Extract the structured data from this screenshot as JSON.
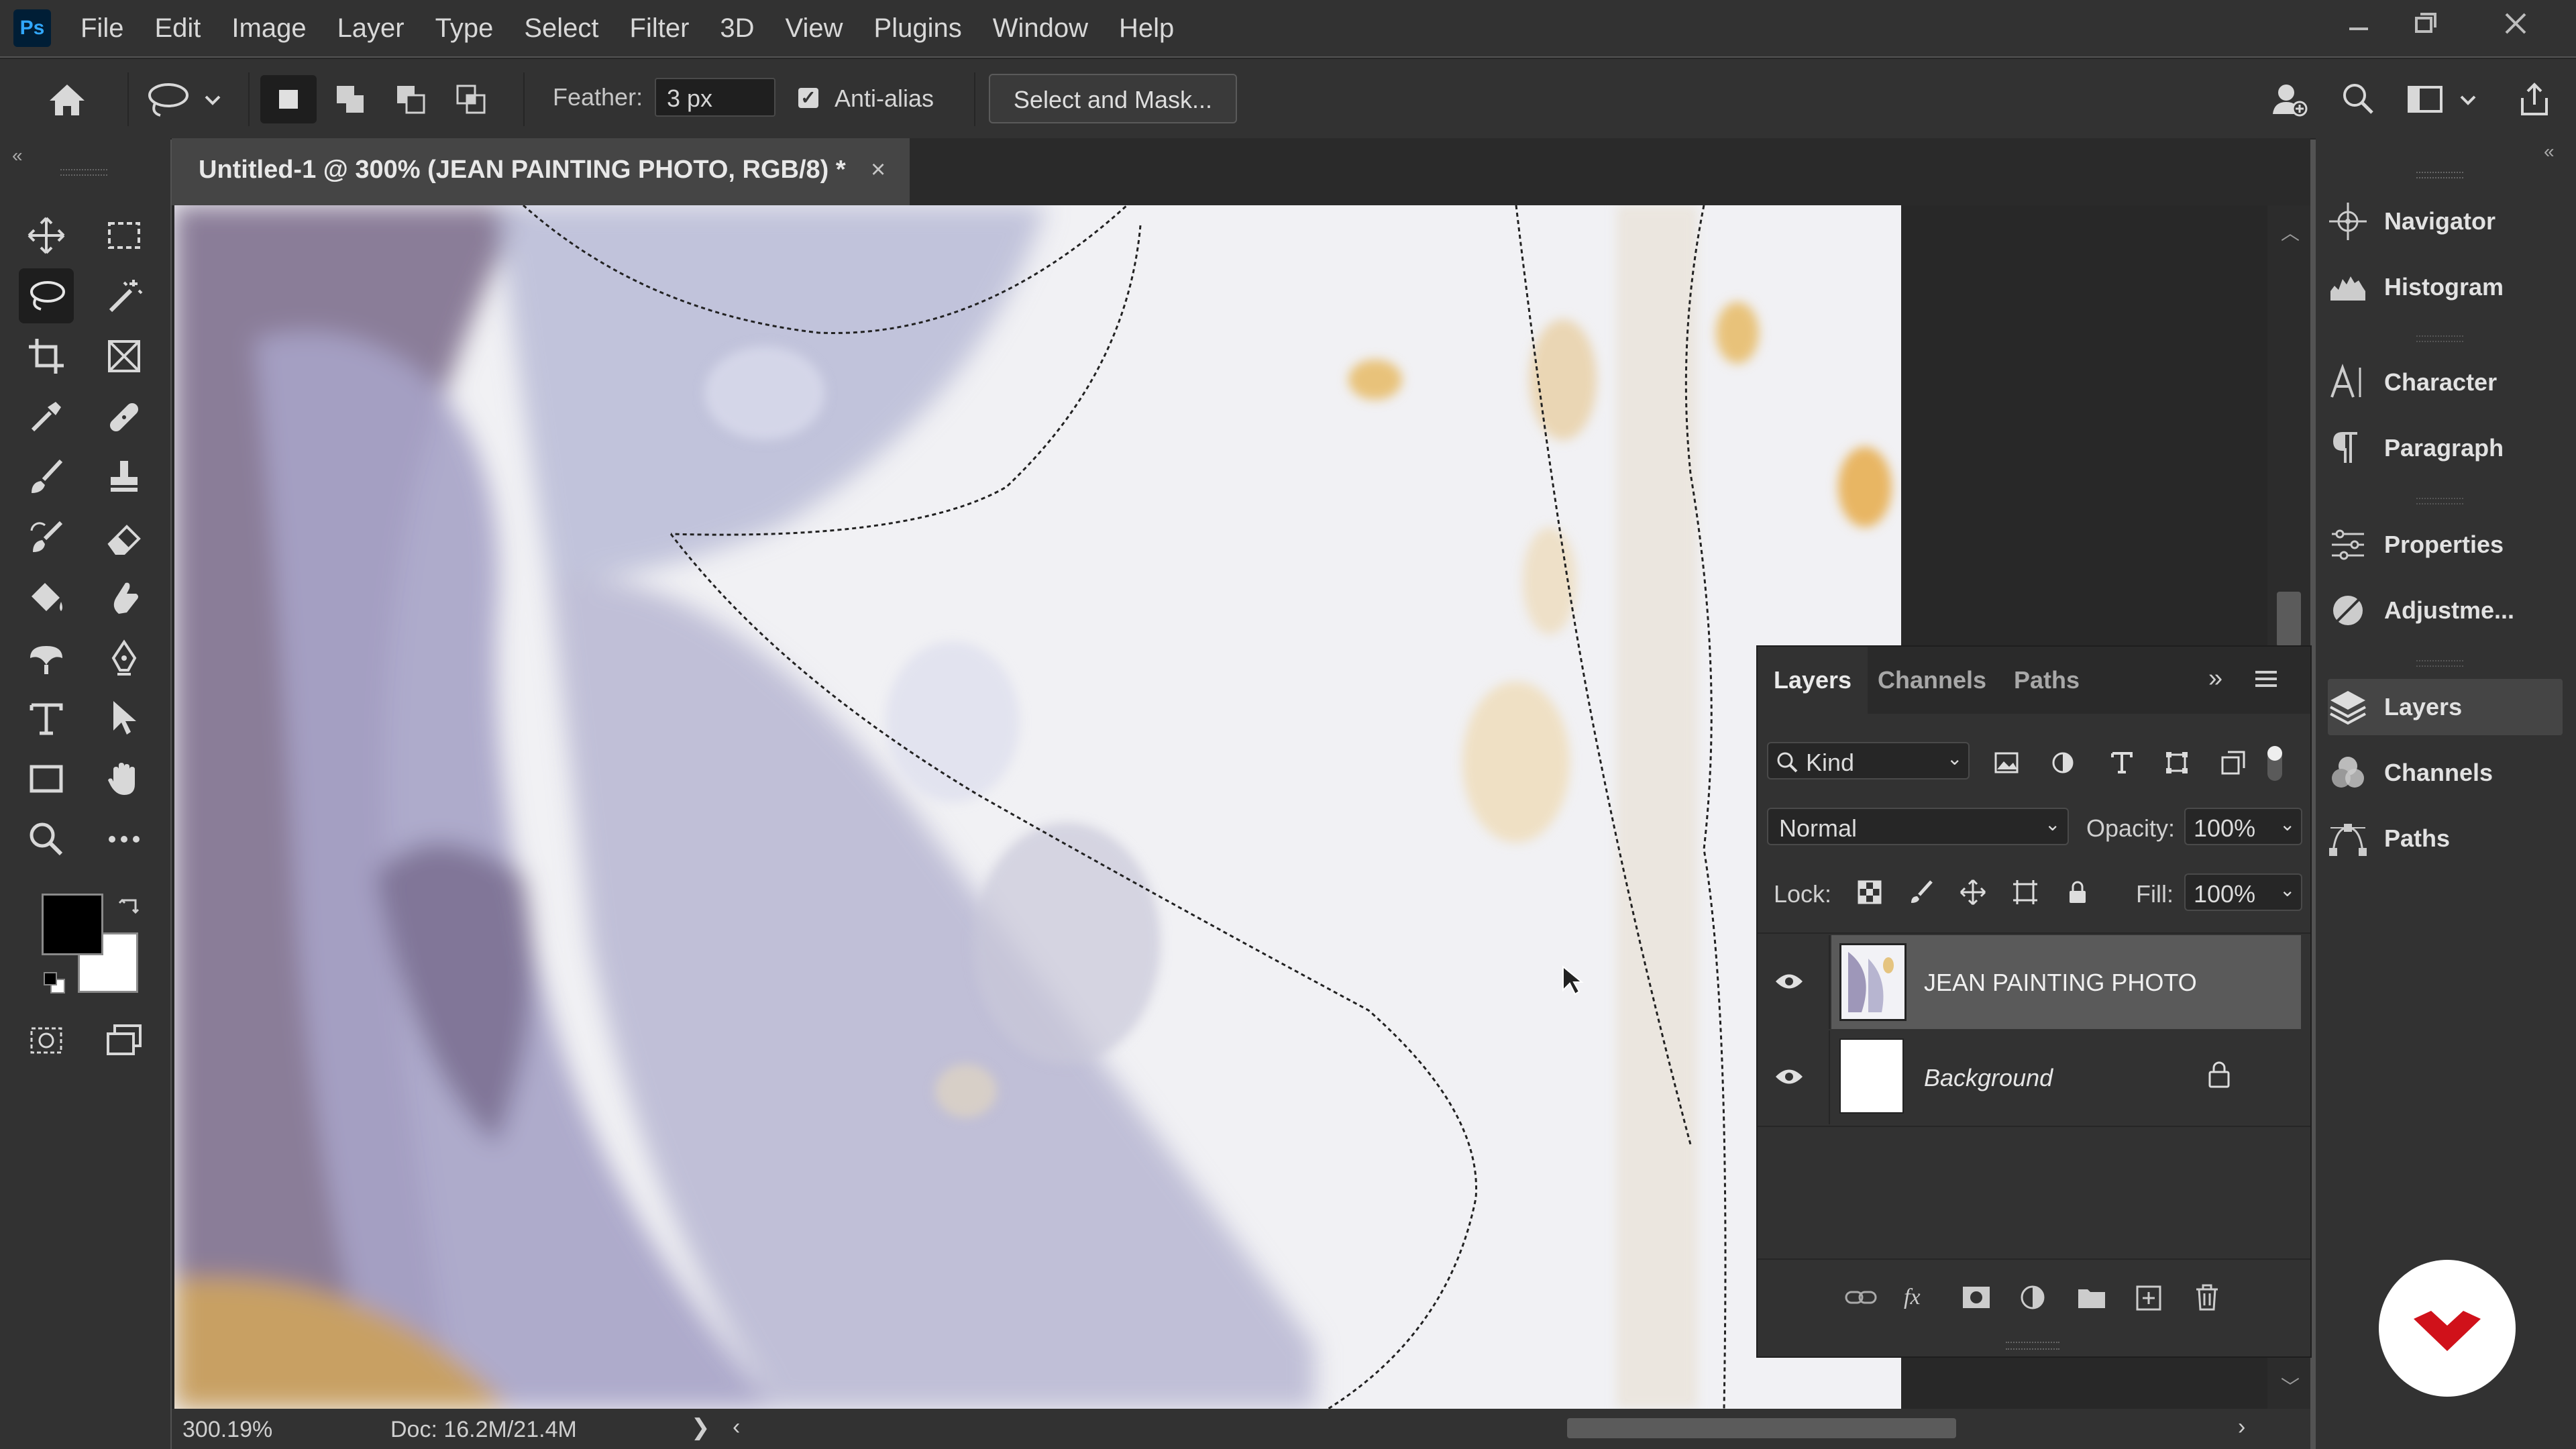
{
  "app": {
    "logo": "Ps",
    "menu": [
      "File",
      "Edit",
      "Image",
      "Layer",
      "Type",
      "Select",
      "Filter",
      "3D",
      "View",
      "Plugins",
      "Window",
      "Help"
    ]
  },
  "options_bar": {
    "feather_label": "Feather:",
    "feather_value": "3 px",
    "anti_alias_label": "Anti-alias",
    "anti_alias_checked": true,
    "select_mask_label": "Select and Mask..."
  },
  "document": {
    "tab_title": "Untitled-1 @ 300% (JEAN PAINTING PHOTO, RGB/8) *",
    "close_glyph": "×"
  },
  "status_bar": {
    "zoom": "300.19%",
    "doc_info": "Doc: 16.2M/21.4M"
  },
  "colors": {
    "foreground": "#000000",
    "background": "#ffffff",
    "accent": "#31a8ff"
  },
  "dock": {
    "items": [
      "Navigator",
      "Histogram",
      "Character",
      "Paragraph",
      "Properties",
      "Adjustme...",
      "Layers",
      "Channels",
      "Paths"
    ],
    "active": "Layers"
  },
  "layers_panel": {
    "tabs": [
      "Layers",
      "Channels",
      "Paths"
    ],
    "filter_kind": "Kind",
    "blend_mode": "Normal",
    "opacity_label": "Opacity:",
    "opacity_value": "100%",
    "lock_label": "Lock:",
    "fill_label": "Fill:",
    "fill_value": "100%",
    "layers": [
      {
        "name": "JEAN PAINTING PHOTO",
        "visible": true,
        "selected": true,
        "locked": false
      },
      {
        "name": "Background",
        "visible": true,
        "selected": false,
        "locked": true
      }
    ]
  }
}
